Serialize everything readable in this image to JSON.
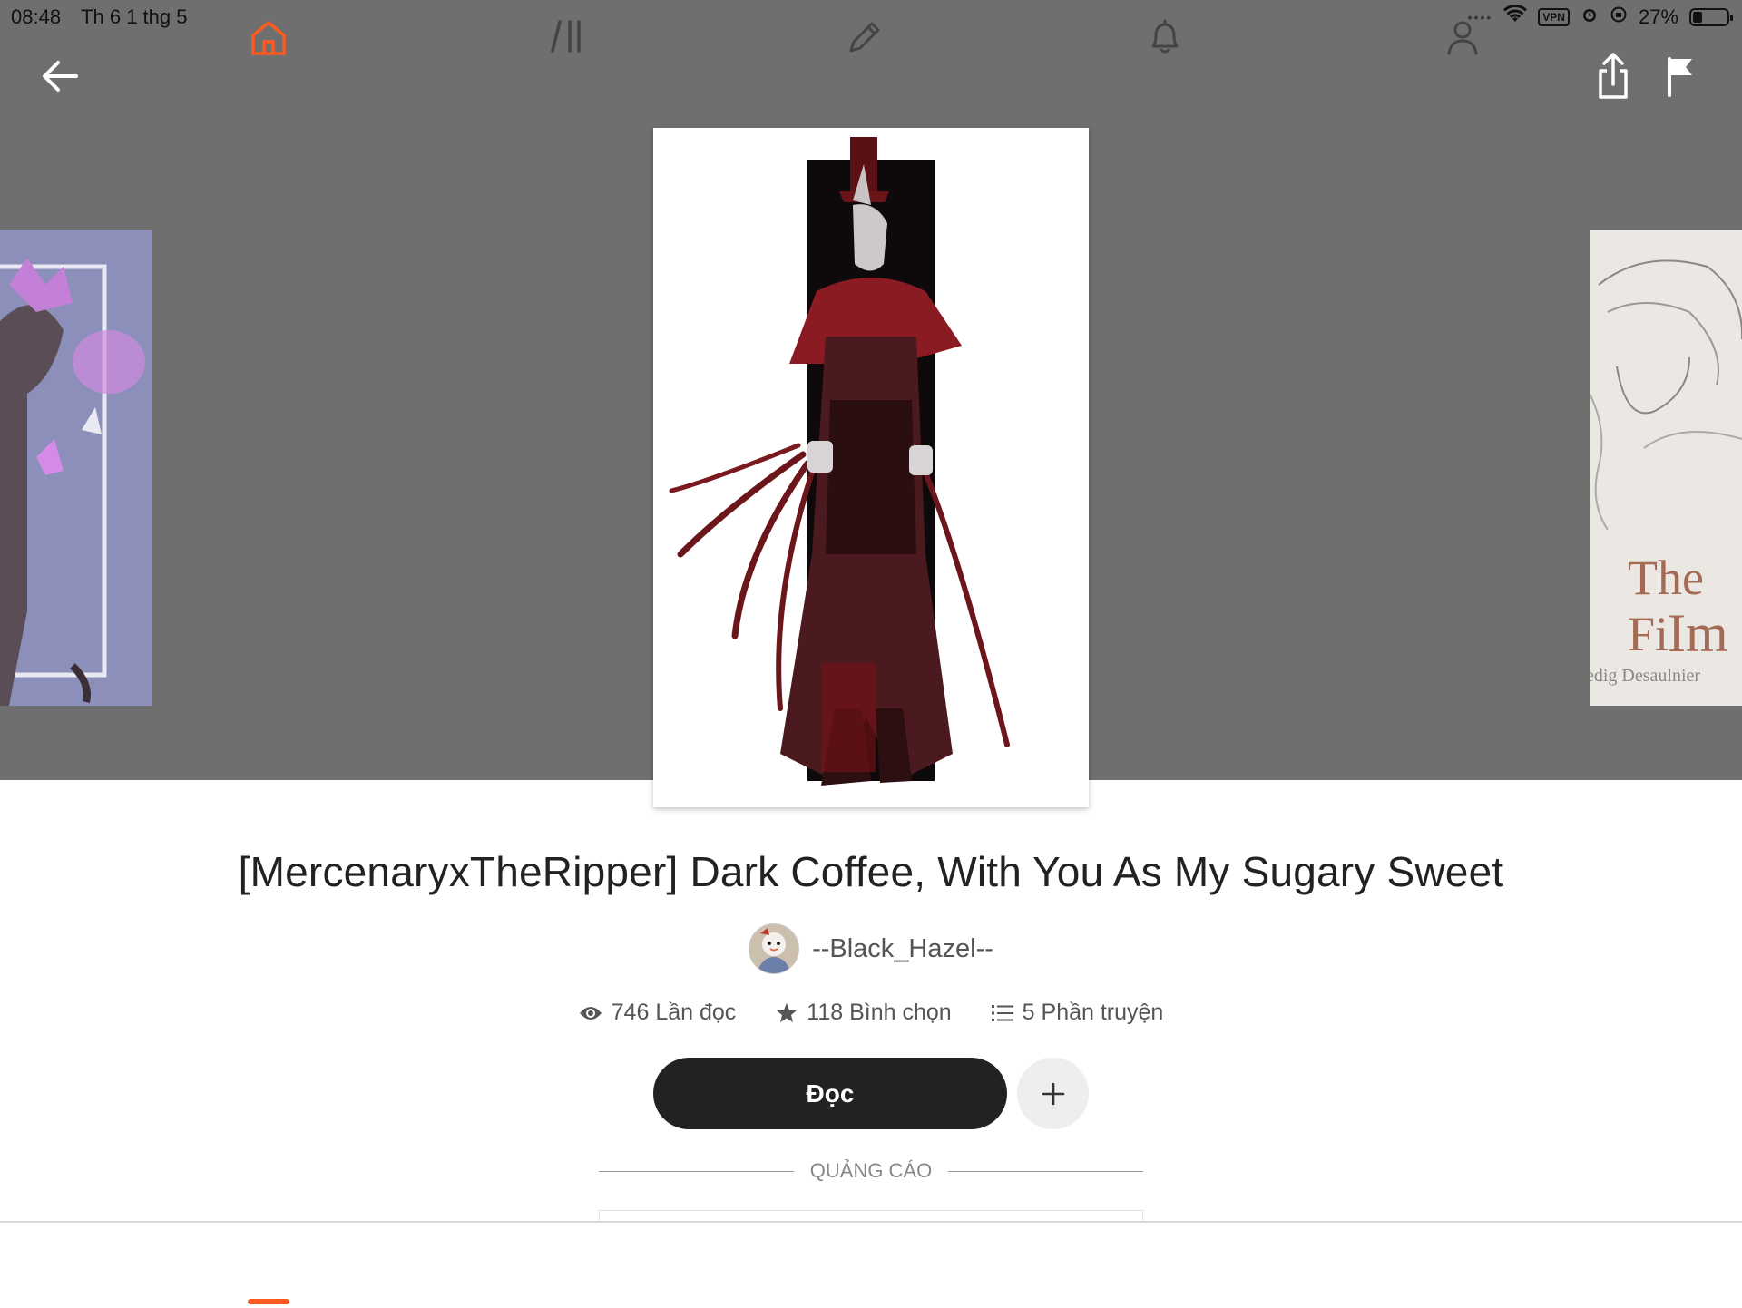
{
  "status_bar": {
    "time": "08:48",
    "date": "Th 6 1 thg 5",
    "vpn_label": "VPN",
    "battery": "27%",
    "battery_level": 0.27
  },
  "toolbar": {
    "back_icon": "arrow-left-icon",
    "share_icon": "share-icon",
    "report_icon": "flag-icon"
  },
  "carousel": {
    "right_cover_text_line1": "The Fi",
    "right_cover_text_line2": "Im",
    "right_cover_signature": "edig Desaulnier"
  },
  "story": {
    "title": "[MercenaryxTheRipper] Dark Coffee, With You As My Sugary Sweet",
    "author": "--Black_Hazel--",
    "reads": "746 Lần đọc",
    "votes": "118 Bình chọn",
    "parts": "5 Phần truyện"
  },
  "actions": {
    "read_label": "Đọc",
    "add_label": "+"
  },
  "ad": {
    "label": "QUẢNG CÁO"
  },
  "tabs": [
    {
      "name": "home",
      "icon": "home-icon",
      "active": true
    },
    {
      "name": "library",
      "icon": "library-icon",
      "active": false
    },
    {
      "name": "write",
      "icon": "pencil-icon",
      "active": false
    },
    {
      "name": "notifications",
      "icon": "bell-icon",
      "active": false
    },
    {
      "name": "profile",
      "icon": "user-icon",
      "active": false
    }
  ],
  "colors": {
    "accent": "#ff5a1f",
    "header_bg": "#6f6f6f",
    "read_button": "#222222"
  }
}
